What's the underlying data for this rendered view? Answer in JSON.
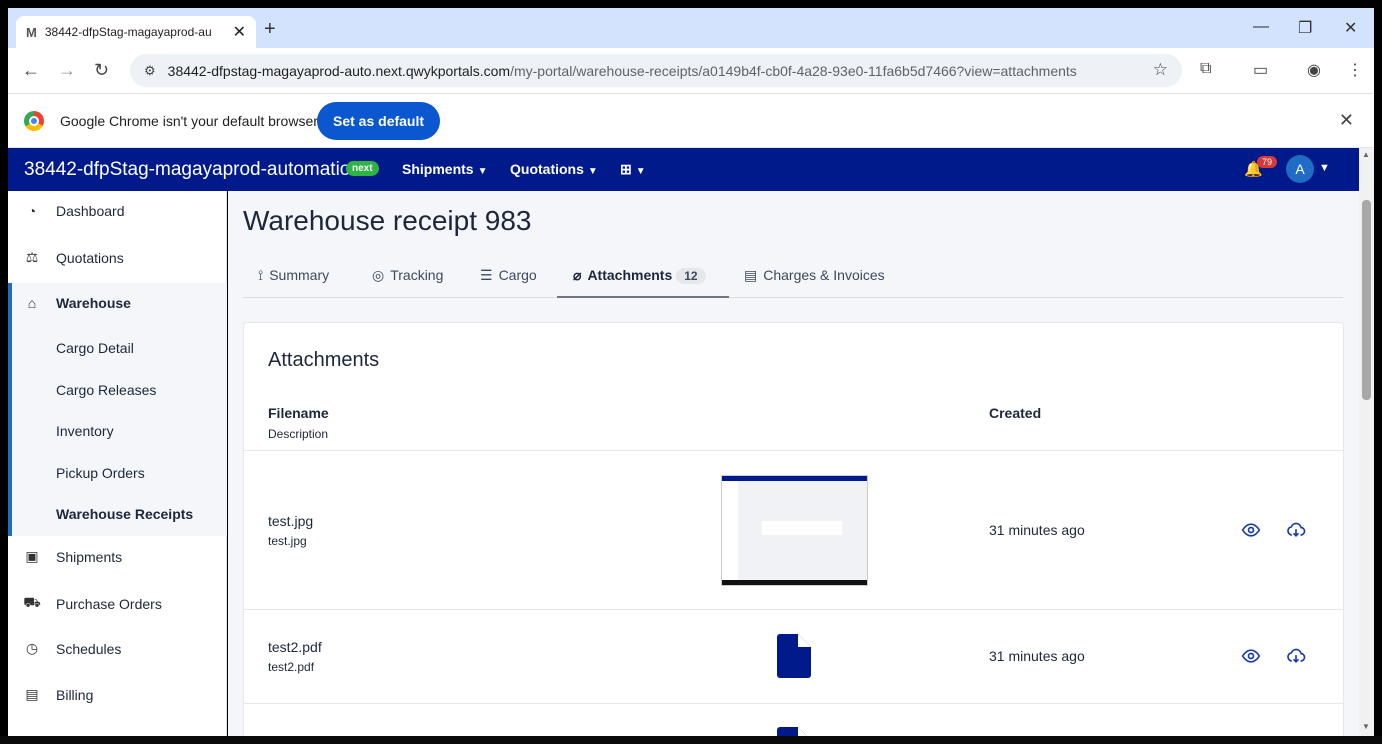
{
  "browser": {
    "tab_title": "38442-dfpStag-magayaprod-au",
    "favicon": "M",
    "url_host": "38442-dfpstag-magayaprod-auto.next.qwykportals.com",
    "url_path": "/my-portal/warehouse-receipts/a0149b4f-cb0f-4a28-93e0-11fa6b5d7466?view=attachments"
  },
  "infobar": {
    "message": "Google Chrome isn't your default browser",
    "button": "Set as default"
  },
  "appbar": {
    "title": "38442-dfpStag-magayaprod-automation",
    "badge": "next",
    "menu": [
      "Shipments",
      "Quotations"
    ],
    "notifications": "79",
    "avatar": "A"
  },
  "sidebar": {
    "items": [
      {
        "label": "Dashboard",
        "icon": "gauge-icon"
      },
      {
        "label": "Quotations",
        "icon": "scale-icon"
      },
      {
        "label": "Warehouse",
        "icon": "warehouse-icon"
      },
      {
        "label": "Shipments",
        "icon": "package-icon"
      },
      {
        "label": "Purchase Orders",
        "icon": "cart-icon"
      },
      {
        "label": "Schedules",
        "icon": "clock-icon"
      },
      {
        "label": "Billing",
        "icon": "billing-icon"
      }
    ],
    "sub_items": [
      "Cargo Detail",
      "Cargo Releases",
      "Inventory",
      "Pickup Orders",
      "Warehouse Receipts"
    ]
  },
  "page": {
    "title": "Warehouse receipt 983",
    "tabs": [
      {
        "label": "Summary"
      },
      {
        "label": "Tracking"
      },
      {
        "label": "Cargo"
      },
      {
        "label": "Attachments",
        "count": "12",
        "active": true
      },
      {
        "label": "Charges & Invoices"
      }
    ]
  },
  "attachments": {
    "title": "Attachments",
    "columns": {
      "filename": "Filename",
      "description": "Description",
      "created": "Created"
    },
    "rows": [
      {
        "filename": "test.jpg",
        "description": "test.jpg",
        "created": "31 minutes ago",
        "preview": "image"
      },
      {
        "filename": "test2.pdf",
        "description": "test2.pdf",
        "created": "31 minutes ago",
        "preview": "file-icon"
      }
    ]
  },
  "colors": {
    "brand": "#001a8c",
    "accent": "#206bc4",
    "badge_green": "#2fb344",
    "notification_red": "#d63939"
  }
}
